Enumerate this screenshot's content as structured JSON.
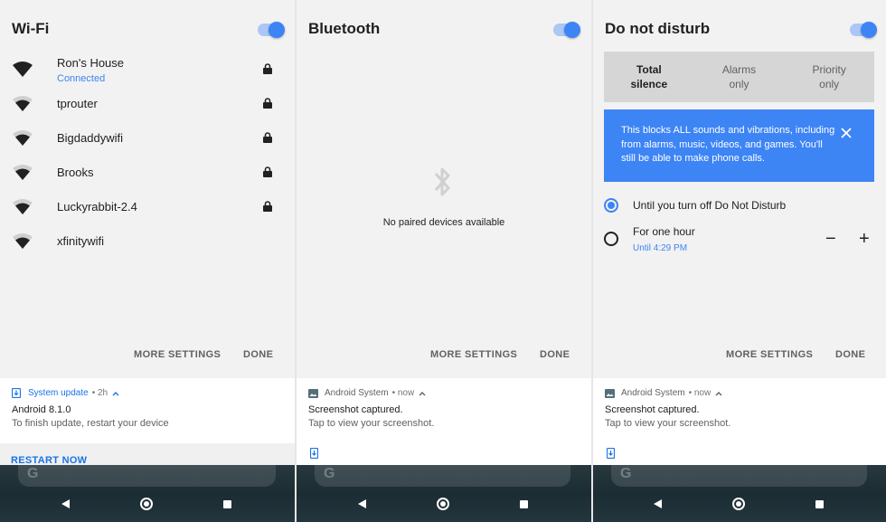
{
  "wifi_panel": {
    "title": "Wi-Fi",
    "networks": [
      {
        "name": "Ron's House",
        "status": "Connected",
        "locked": true
      },
      {
        "name": "tprouter",
        "status": "",
        "locked": true
      },
      {
        "name": "Bigdaddywifi",
        "status": "",
        "locked": true
      },
      {
        "name": "Brooks",
        "status": "",
        "locked": true
      },
      {
        "name": "Luckyrabbit-2.4",
        "status": "",
        "locked": true
      },
      {
        "name": "xfinitywifi",
        "status": "",
        "locked": false
      }
    ],
    "more_settings": "MORE SETTINGS",
    "done": "DONE",
    "notification": {
      "app": "System update",
      "meta": "• 2h",
      "title": "Android 8.1.0",
      "text": "To finish update, restart your device",
      "action": "RESTART NOW"
    }
  },
  "bluetooth_panel": {
    "title": "Bluetooth",
    "empty_text": "No paired devices available",
    "more_settings": "MORE SETTINGS",
    "done": "DONE",
    "notification": {
      "app": "Android System",
      "meta": "• now",
      "title": "Screenshot captured.",
      "text": "Tap to view your screenshot."
    }
  },
  "dnd_panel": {
    "title": "Do not disturb",
    "tabs": [
      {
        "line1": "Total",
        "line2": "silence",
        "selected": true
      },
      {
        "line1": "Alarms",
        "line2": "only",
        "selected": false
      },
      {
        "line1": "Priority",
        "line2": "only",
        "selected": false
      }
    ],
    "banner": "This blocks ALL sounds and vibrations, including from alarms, music, videos, and games. You'll still be able to make phone calls.",
    "option_1": "Until you turn off Do Not Disturb",
    "option_2": "For one hour",
    "option_2_sub": "Until 4:29 PM",
    "minus": "−",
    "plus": "+",
    "more_settings": "MORE SETTINGS",
    "done": "DONE",
    "notification": {
      "app": "Android System",
      "meta": "• now",
      "title": "Screenshot captured.",
      "text": "Tap to view your screenshot."
    }
  },
  "navbar": {
    "search_letter": "G"
  },
  "colors": {
    "accent": "#3d84f5",
    "panel_bg": "#f2f2f2",
    "nav_bg": "#1c2c33"
  }
}
